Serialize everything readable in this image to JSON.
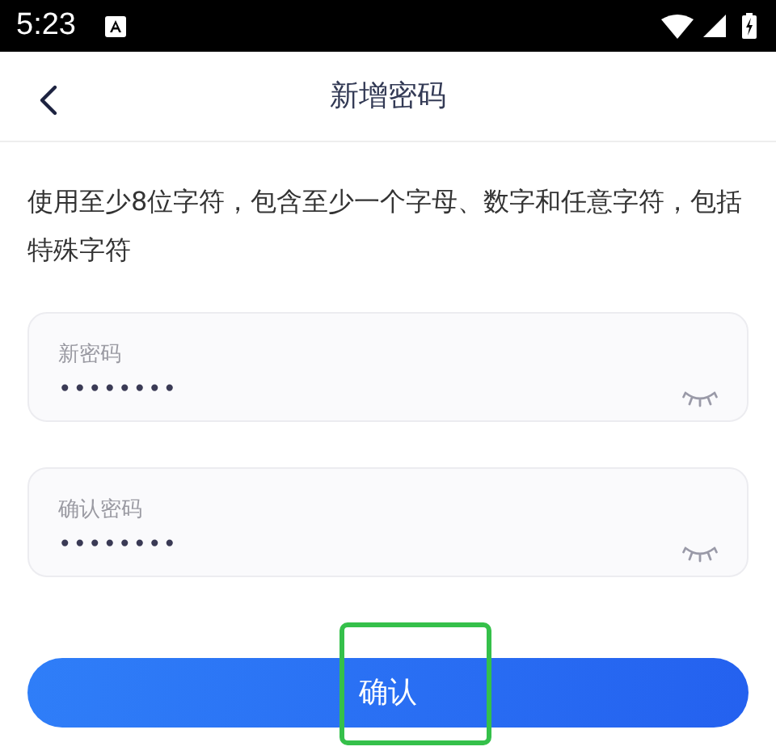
{
  "status_bar": {
    "time": "5:23"
  },
  "header": {
    "title": "新增密码"
  },
  "hint": "使用至少8位字符，包含至少一个字母、数字和任意字符，包括特殊字符",
  "fields": [
    {
      "label": "新密码",
      "value": "••••••••",
      "revealed": false
    },
    {
      "label": "确认密码",
      "value": "••••••••",
      "revealed": false
    }
  ],
  "confirm_button": {
    "label": "确认",
    "highlighted": true
  }
}
